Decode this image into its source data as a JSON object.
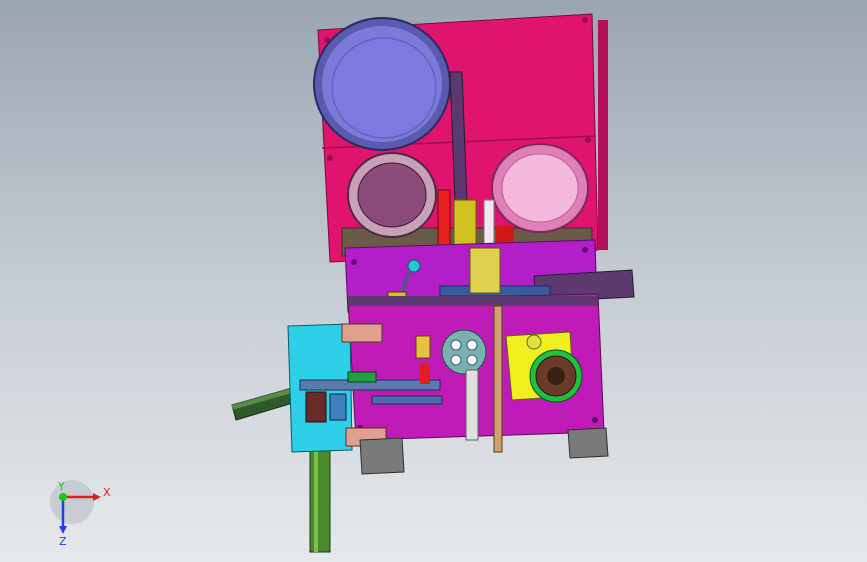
{
  "viewport": {
    "background_top": "#9aa5b2",
    "background_bottom": "#e6e9ec"
  },
  "triad": {
    "x_label": "X",
    "y_label": "Y",
    "z_label": "Z",
    "x_color": "#e02020",
    "y_color": "#20c020",
    "z_color": "#2040e0"
  },
  "colors": {
    "upper_plate": "#e0146e",
    "mid_plate": "#b41ec8",
    "lower_plate": "#c01ab8",
    "left_plate": "#2ed0e8",
    "bowl_large": "#7a7ad8",
    "bowl_dark": "#8a4a7a",
    "bowl_light": "#f3b8dc",
    "feeder_arm": "#5c3a70",
    "yellow_plate": "#f0f020",
    "green_chute": "#4a8a2a",
    "grey_feet": "#7a7a7a",
    "tan_block": "#6a5a48"
  }
}
